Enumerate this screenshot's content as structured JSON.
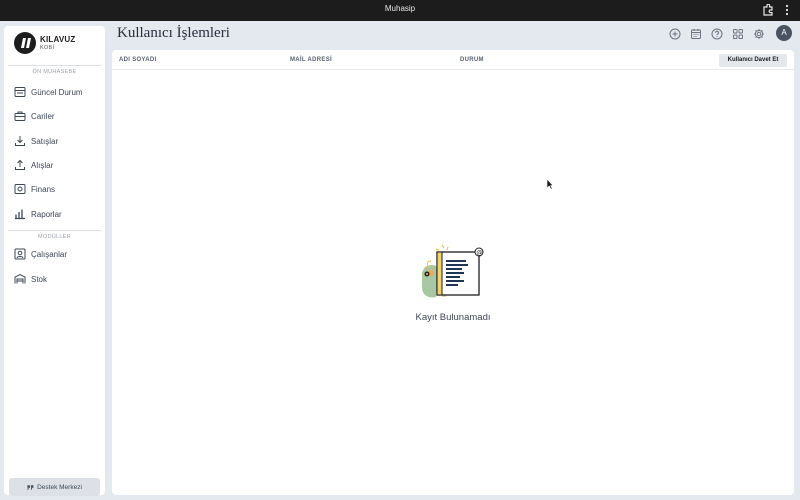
{
  "window": {
    "title": "Muhasip"
  },
  "brand": {
    "name": "KILAVUZ",
    "sub": "KOBİ"
  },
  "sidebar": {
    "sections": [
      {
        "label": "ÖN MUHASEBE"
      },
      {
        "label": "MODÜLLER"
      }
    ],
    "items": [
      {
        "label": "Güncel Durum",
        "icon": "store-icon"
      },
      {
        "label": "Cariler",
        "icon": "briefcase-icon"
      },
      {
        "label": "Satışlar",
        "icon": "download-icon"
      },
      {
        "label": "Alışlar",
        "icon": "upload-icon"
      },
      {
        "label": "Finans",
        "icon": "safe-icon"
      },
      {
        "label": "Raporlar",
        "icon": "bar-chart-icon"
      },
      {
        "label": "Çalışanlar",
        "icon": "person-icon"
      },
      {
        "label": "Stok",
        "icon": "warehouse-icon"
      }
    ],
    "support_label": "Destek Merkezi"
  },
  "header": {
    "title": "Kullanıcı İşlemleri",
    "icons": [
      "add-circle-icon",
      "calendar-icon",
      "help-icon",
      "apps-icon",
      "settings-icon"
    ],
    "avatar_initial": "A"
  },
  "table": {
    "columns": [
      "ADI SOYADI",
      "MAİL ADRESİ",
      "DURUM"
    ],
    "invite_label": "Kullanıcı Davet Et",
    "empty_text": "Kayıt Bulunamadı"
  },
  "colors": {
    "sidebar_bg": "#ffffff",
    "app_bg": "#e4e8ef",
    "text": "#3d4656"
  }
}
